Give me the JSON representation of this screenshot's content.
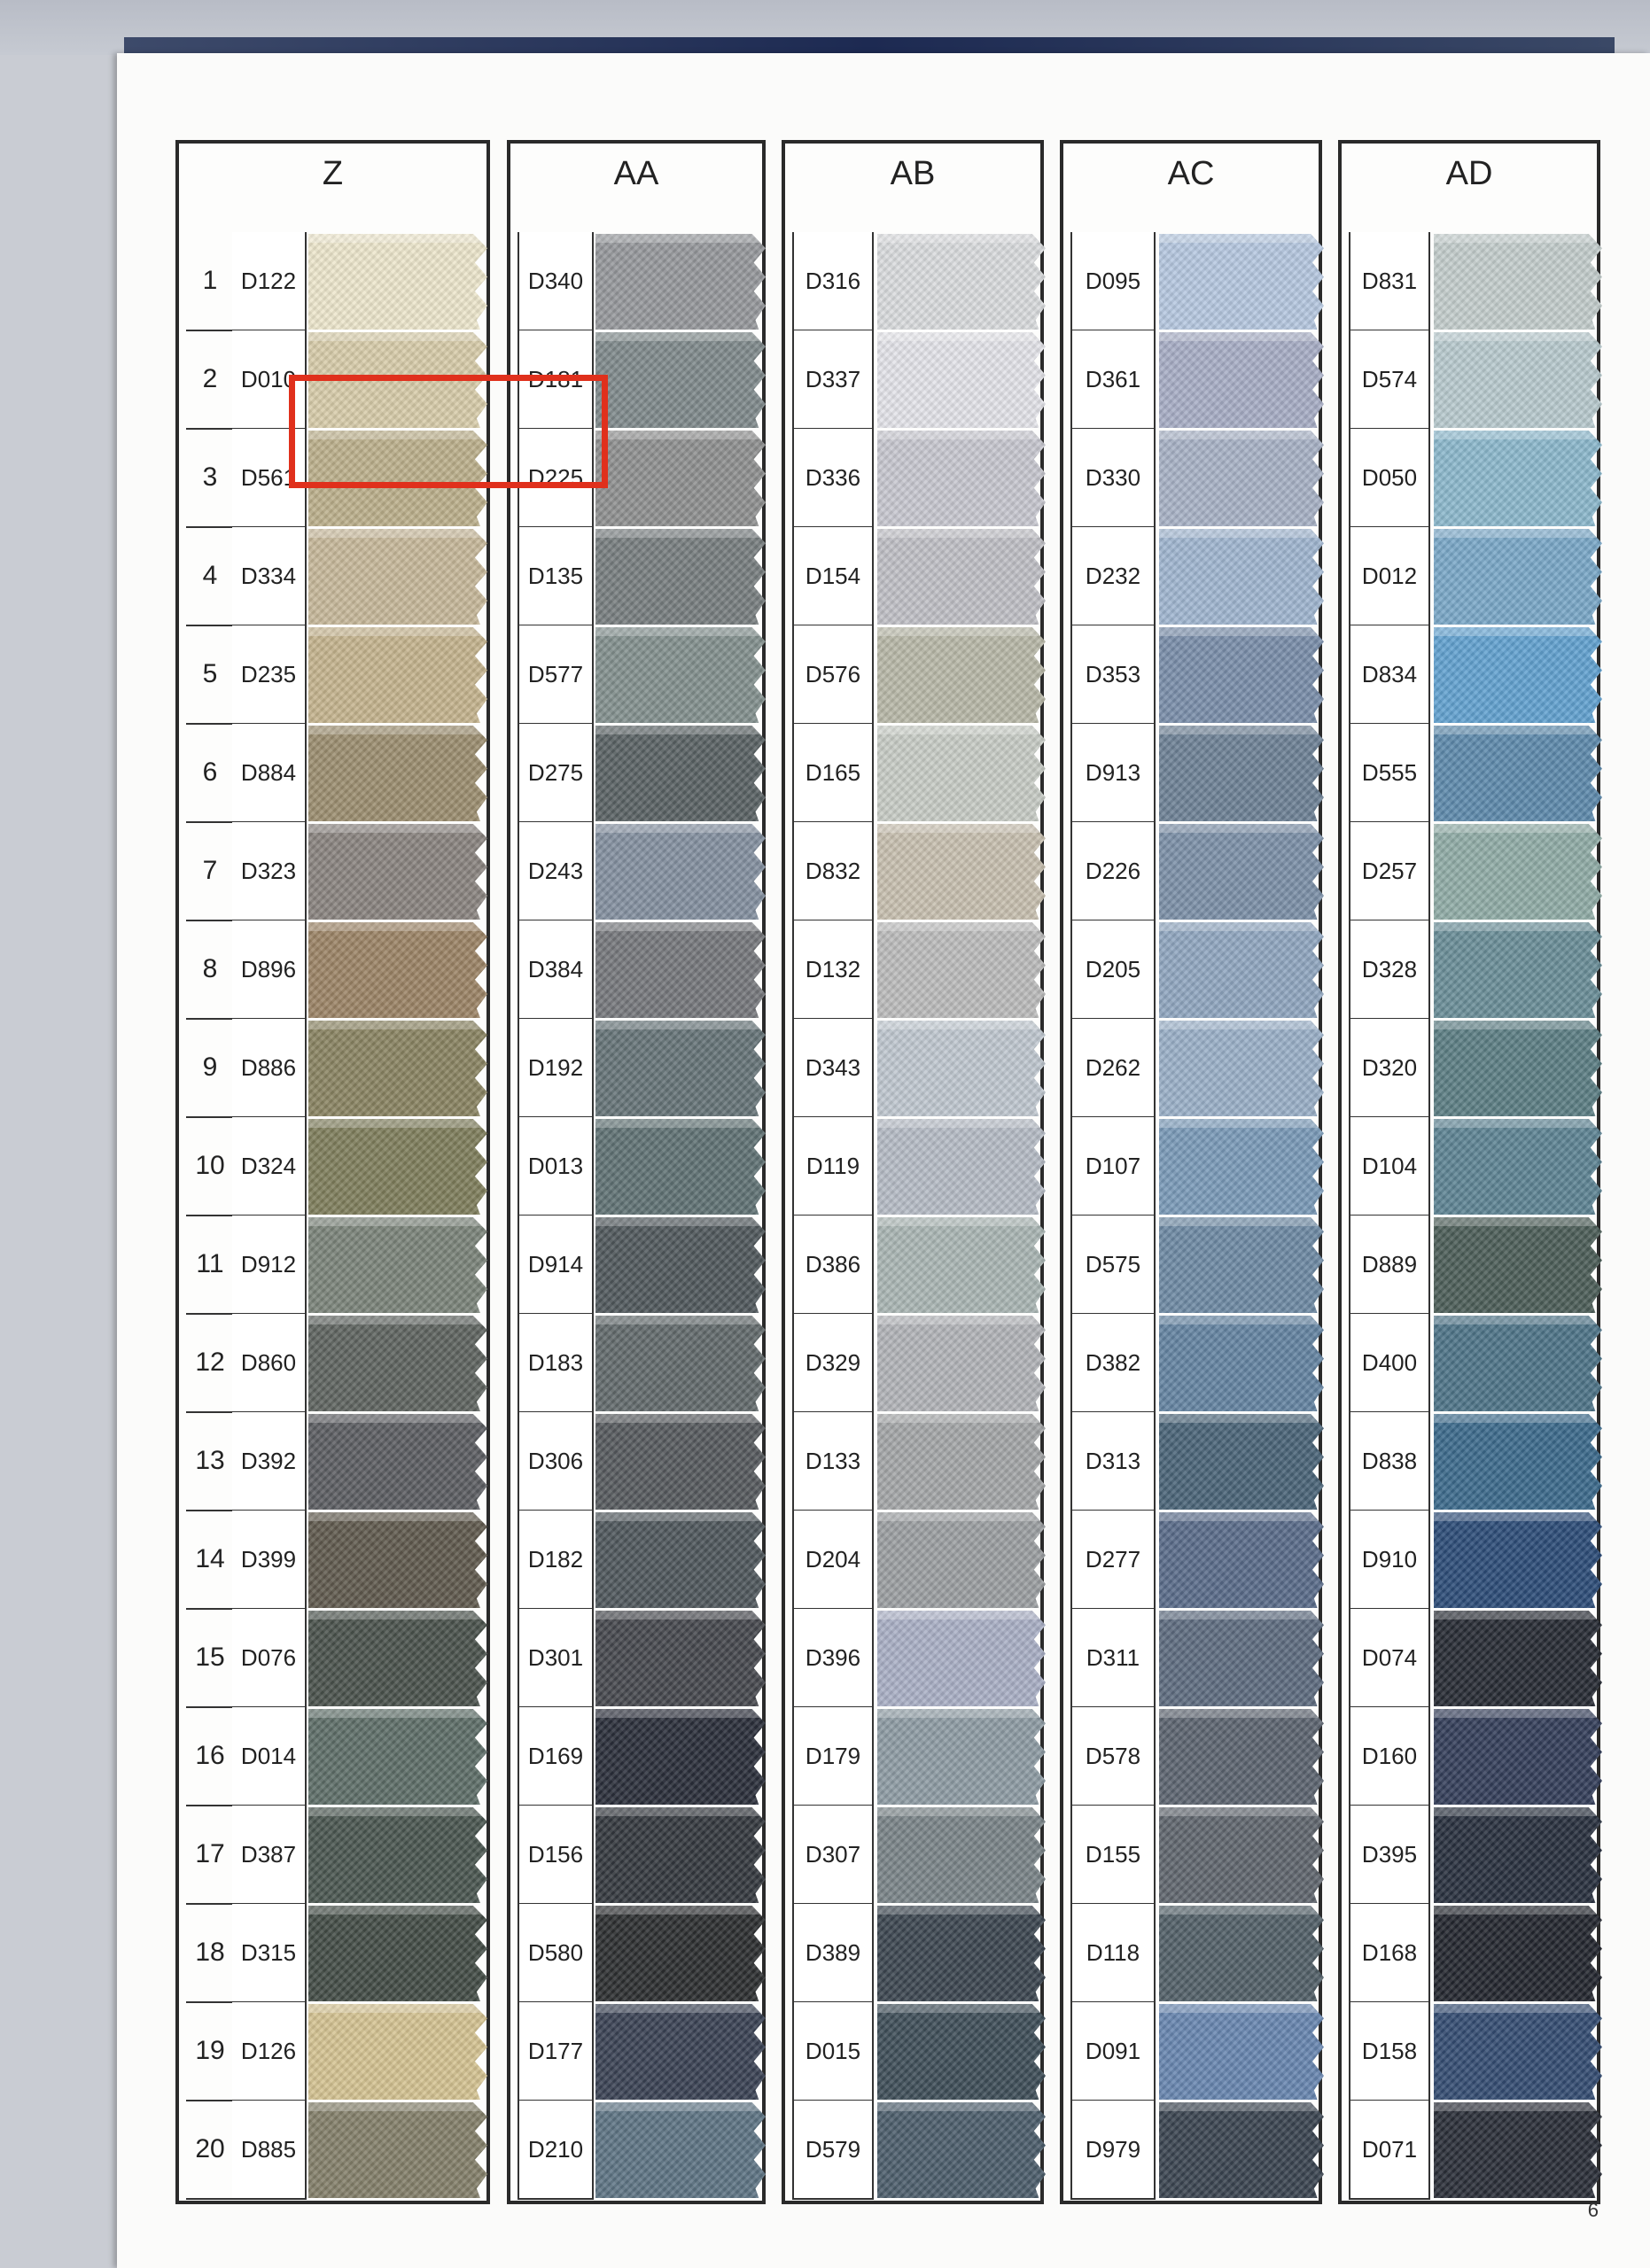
{
  "page_number": "6",
  "columns": [
    {
      "title": "Z",
      "rows": [
        {
          "num": "1",
          "code": "D122",
          "color": "#ede7cc"
        },
        {
          "num": "2",
          "code": "D010",
          "color": "#d8ccaa"
        },
        {
          "num": "3",
          "code": "D561",
          "color": "#bcb08c"
        },
        {
          "num": "4",
          "code": "D334",
          "color": "#c7b89a"
        },
        {
          "num": "5",
          "code": "D235",
          "color": "#c5b48e"
        },
        {
          "num": "6",
          "code": "D884",
          "color": "#9c8e70"
        },
        {
          "num": "7",
          "code": "D323",
          "color": "#8a8480"
        },
        {
          "num": "8",
          "code": "D896",
          "color": "#9c8466"
        },
        {
          "num": "9",
          "code": "D886",
          "color": "#8a8462"
        },
        {
          "num": "10",
          "code": "D324",
          "color": "#7f7e5c"
        },
        {
          "num": "11",
          "code": "D912",
          "color": "#7b847a"
        },
        {
          "num": "12",
          "code": "D860",
          "color": "#5f6460"
        },
        {
          "num": "13",
          "code": "D392",
          "color": "#5c5e62"
        },
        {
          "num": "14",
          "code": "D399",
          "color": "#605a4e"
        },
        {
          "num": "15",
          "code": "D076",
          "color": "#4a524c"
        },
        {
          "num": "16",
          "code": "D014",
          "color": "#5e6e68"
        },
        {
          "num": "17",
          "code": "D387",
          "color": "#4a5650"
        },
        {
          "num": "18",
          "code": "D315",
          "color": "#434c46"
        },
        {
          "num": "19",
          "code": "D126",
          "color": "#d5c392"
        },
        {
          "num": "20",
          "code": "D885",
          "color": "#84806a"
        }
      ]
    },
    {
      "title": "AA",
      "rows": [
        {
          "code": "D340",
          "color": "#96989c"
        },
        {
          "code": "D181",
          "color": "#808a8c"
        },
        {
          "code": "D225",
          "color": "#8f9090"
        },
        {
          "code": "D135",
          "color": "#787e80"
        },
        {
          "code": "D577",
          "color": "#83908e"
        },
        {
          "code": "D275",
          "color": "#5a6264"
        },
        {
          "code": "D243",
          "color": "#8490a0"
        },
        {
          "code": "D384",
          "color": "#76787c"
        },
        {
          "code": "D192",
          "color": "#667478"
        },
        {
          "code": "D013",
          "color": "#607274"
        },
        {
          "code": "D914",
          "color": "#50585c"
        },
        {
          "code": "D183",
          "color": "#626a6c"
        },
        {
          "code": "D306",
          "color": "#565a5e"
        },
        {
          "code": "D182",
          "color": "#4f575c"
        },
        {
          "code": "D301",
          "color": "#46484e"
        },
        {
          "code": "D169",
          "color": "#2a2e3a"
        },
        {
          "code": "D156",
          "color": "#34383e"
        },
        {
          "code": "D580",
          "color": "#2c2e30"
        },
        {
          "code": "D177",
          "color": "#3a4254"
        },
        {
          "code": "D210",
          "color": "#5e7484"
        }
      ]
    },
    {
      "title": "AB",
      "rows": [
        {
          "code": "D316",
          "color": "#dadcde"
        },
        {
          "code": "D337",
          "color": "#e4e4ea"
        },
        {
          "code": "D336",
          "color": "#c8c8d0"
        },
        {
          "code": "D154",
          "color": "#c0c0c6"
        },
        {
          "code": "D576",
          "color": "#b8b8a8"
        },
        {
          "code": "D165",
          "color": "#c8ccc6"
        },
        {
          "code": "D832",
          "color": "#c8c0b0"
        },
        {
          "code": "D132",
          "color": "#bcbcbc"
        },
        {
          "code": "D343",
          "color": "#c0c8d0"
        },
        {
          "code": "D119",
          "color": "#b6bcc6"
        },
        {
          "code": "D386",
          "color": "#aab6b4"
        },
        {
          "code": "D329",
          "color": "#b2b4b8"
        },
        {
          "code": "D133",
          "color": "#a4a6a8"
        },
        {
          "code": "D204",
          "color": "#9c9fa2"
        },
        {
          "code": "D396",
          "color": "#aab0c6"
        },
        {
          "code": "D179",
          "color": "#8e9ca4"
        },
        {
          "code": "D307",
          "color": "#7a8488"
        },
        {
          "code": "D389",
          "color": "#3c4650"
        },
        {
          "code": "D015",
          "color": "#3e4e58"
        },
        {
          "code": "D579",
          "color": "#4c5e6c"
        }
      ]
    },
    {
      "title": "AC",
      "rows": [
        {
          "code": "D095",
          "color": "#b6c8e0"
        },
        {
          "code": "D361",
          "color": "#a8aec6"
        },
        {
          "code": "D330",
          "color": "#a8b2c6"
        },
        {
          "code": "D232",
          "color": "#a0b6d0"
        },
        {
          "code": "D353",
          "color": "#7a8eaa"
        },
        {
          "code": "D913",
          "color": "#6e8296"
        },
        {
          "code": "D226",
          "color": "#7c90a8"
        },
        {
          "code": "D205",
          "color": "#90a6c0"
        },
        {
          "code": "D262",
          "color": "#9ab0c8"
        },
        {
          "code": "D107",
          "color": "#7a9ab8"
        },
        {
          "code": "D575",
          "color": "#6e8aa4"
        },
        {
          "code": "D382",
          "color": "#6484a2"
        },
        {
          "code": "D313",
          "color": "#4a6478"
        },
        {
          "code": "D277",
          "color": "#5a6c8a"
        },
        {
          "code": "D311",
          "color": "#5e6c80"
        },
        {
          "code": "D578",
          "color": "#5c6470"
        },
        {
          "code": "D155",
          "color": "#60666e"
        },
        {
          "code": "D118",
          "color": "#526068"
        },
        {
          "code": "D091",
          "color": "#6886b0"
        },
        {
          "code": "D979",
          "color": "#3a4450"
        }
      ]
    },
    {
      "title": "AD",
      "rows": [
        {
          "code": "D831",
          "color": "#c4cdcc"
        },
        {
          "code": "D574",
          "color": "#b8cace"
        },
        {
          "code": "D050",
          "color": "#8cb8cc"
        },
        {
          "code": "D012",
          "color": "#7aa8c8"
        },
        {
          "code": "D834",
          "color": "#62a2d0"
        },
        {
          "code": "D555",
          "color": "#5e8aac"
        },
        {
          "code": "D257",
          "color": "#90aca6"
        },
        {
          "code": "D328",
          "color": "#6a8e98"
        },
        {
          "code": "D320",
          "color": "#5c7e84"
        },
        {
          "code": "D104",
          "color": "#5e8494"
        },
        {
          "code": "D889",
          "color": "#4c5e58"
        },
        {
          "code": "D400",
          "color": "#4e7488"
        },
        {
          "code": "D838",
          "color": "#3c6a8c"
        },
        {
          "code": "D910",
          "color": "#2c4c78"
        },
        {
          "code": "D074",
          "color": "#272b34"
        },
        {
          "code": "D160",
          "color": "#343e5a"
        },
        {
          "code": "D395",
          "color": "#28303e"
        },
        {
          "code": "D168",
          "color": "#23262e"
        },
        {
          "code": "D158",
          "color": "#344c72"
        },
        {
          "code": "D071",
          "color": "#2a2e38"
        }
      ]
    }
  ]
}
